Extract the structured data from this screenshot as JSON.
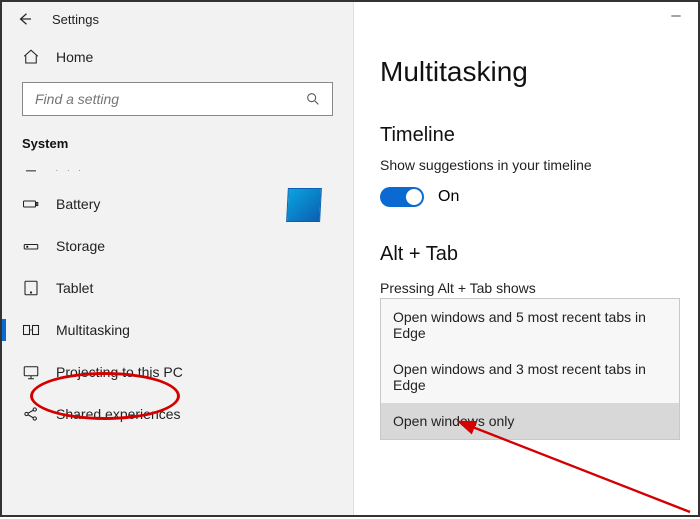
{
  "titlebar": {
    "app_name": "Settings"
  },
  "home_label": "Home",
  "search": {
    "placeholder": "Find a setting"
  },
  "section_label": "System",
  "nav": [
    {
      "icon": "battery-icon",
      "label": "Battery"
    },
    {
      "icon": "storage-icon",
      "label": "Storage"
    },
    {
      "icon": "tablet-icon",
      "label": "Tablet"
    },
    {
      "icon": "multitask-icon",
      "label": "Multitasking",
      "selected": true
    },
    {
      "icon": "project-icon",
      "label": "Projecting to this PC"
    },
    {
      "icon": "share-icon",
      "label": "Shared experiences"
    }
  ],
  "page": {
    "title": "Multitasking",
    "timeline": {
      "heading": "Timeline",
      "label": "Show suggestions in your timeline",
      "toggle_state": "On"
    },
    "alttab": {
      "heading": "Alt + Tab",
      "label": "Pressing Alt + Tab shows",
      "options": [
        "Open windows and 5 most recent tabs in Edge",
        "Open windows and 3 most recent tabs in Edge",
        "Open windows only"
      ],
      "selected_index": 2
    }
  }
}
